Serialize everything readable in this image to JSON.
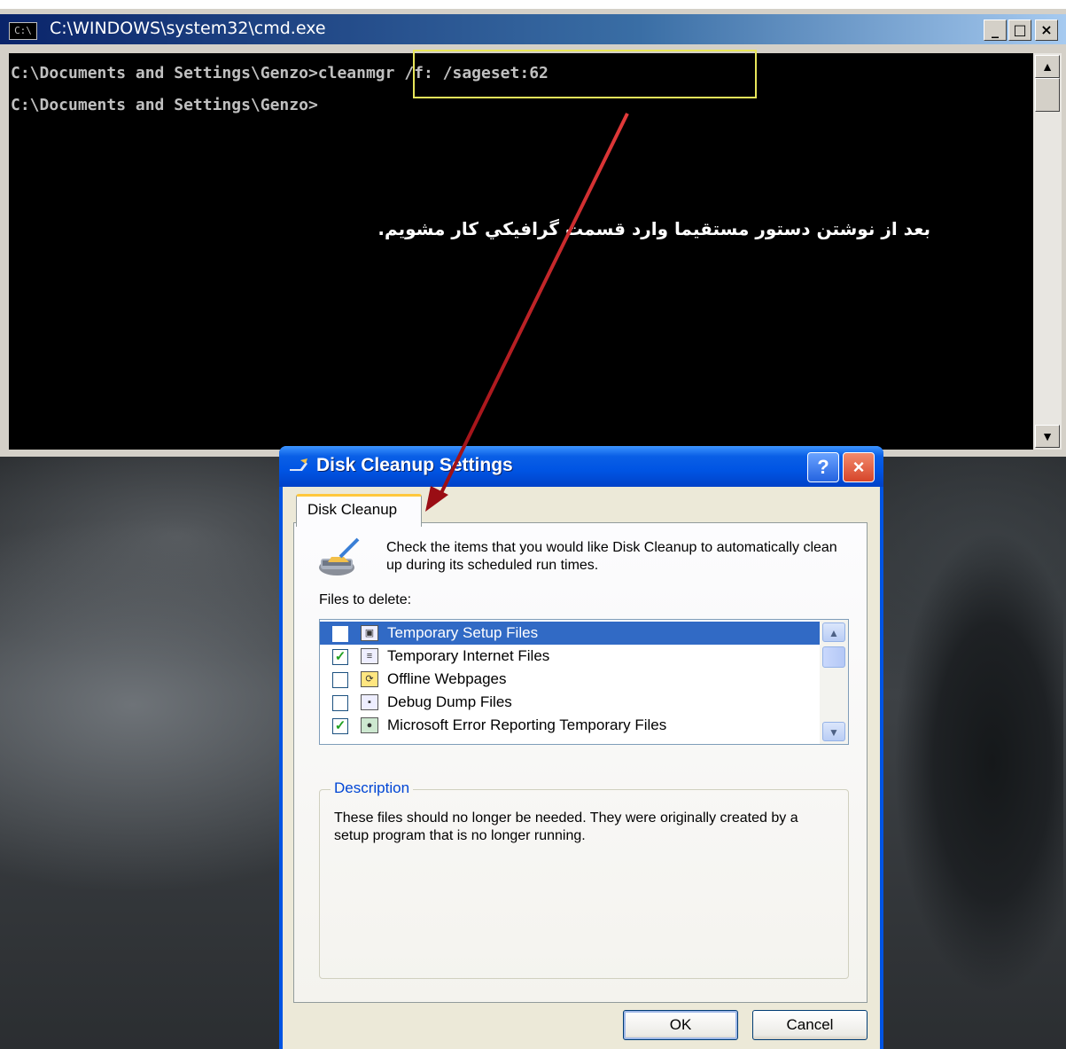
{
  "cmd_window": {
    "title": "C:\\WINDOWS\\system32\\cmd.exe",
    "icon": "C:\\",
    "buttons": {
      "minimize": "_",
      "maximize": "□",
      "close": "×"
    },
    "lines": [
      "C:\\Documents and Settings\\Genzo>cleanmgr /f: /sageset:62",
      "C:\\Documents and Settings\\Genzo>"
    ],
    "annotation": "بعد از نوشتن دستور مستقیما وارد قسمت گرافیکي کار مشویم.",
    "highlight_color": "#e8e65a"
  },
  "dialog": {
    "title": "Disk Cleanup Settings",
    "help": "?",
    "close": "×",
    "tab": "Disk Cleanup",
    "intro": "Check the items that you would like Disk Cleanup to automatically clean up during its scheduled run times.",
    "files_label": "Files to delete:",
    "items": [
      {
        "label": "Temporary Setup Files",
        "checked": false,
        "selected": true,
        "icon": "setup-files-icon"
      },
      {
        "label": "Temporary Internet Files",
        "checked": true,
        "selected": false,
        "icon": "internet-files-icon"
      },
      {
        "label": "Offline Webpages",
        "checked": false,
        "selected": false,
        "icon": "offline-webpages-icon"
      },
      {
        "label": "Debug Dump Files",
        "checked": false,
        "selected": false,
        "icon": "debug-dump-icon"
      },
      {
        "label": "Microsoft Error Reporting Temporary Files",
        "checked": true,
        "selected": false,
        "icon": "error-reporting-icon"
      }
    ],
    "description_title": "Description",
    "description": "These files should no longer be needed. They were originally created by a setup program that is no longer running.",
    "ok": "OK",
    "cancel": "Cancel"
  },
  "colors": {
    "arrow": "#c1121f",
    "xp_blue": "#0054e3",
    "selection": "#316ac5"
  }
}
